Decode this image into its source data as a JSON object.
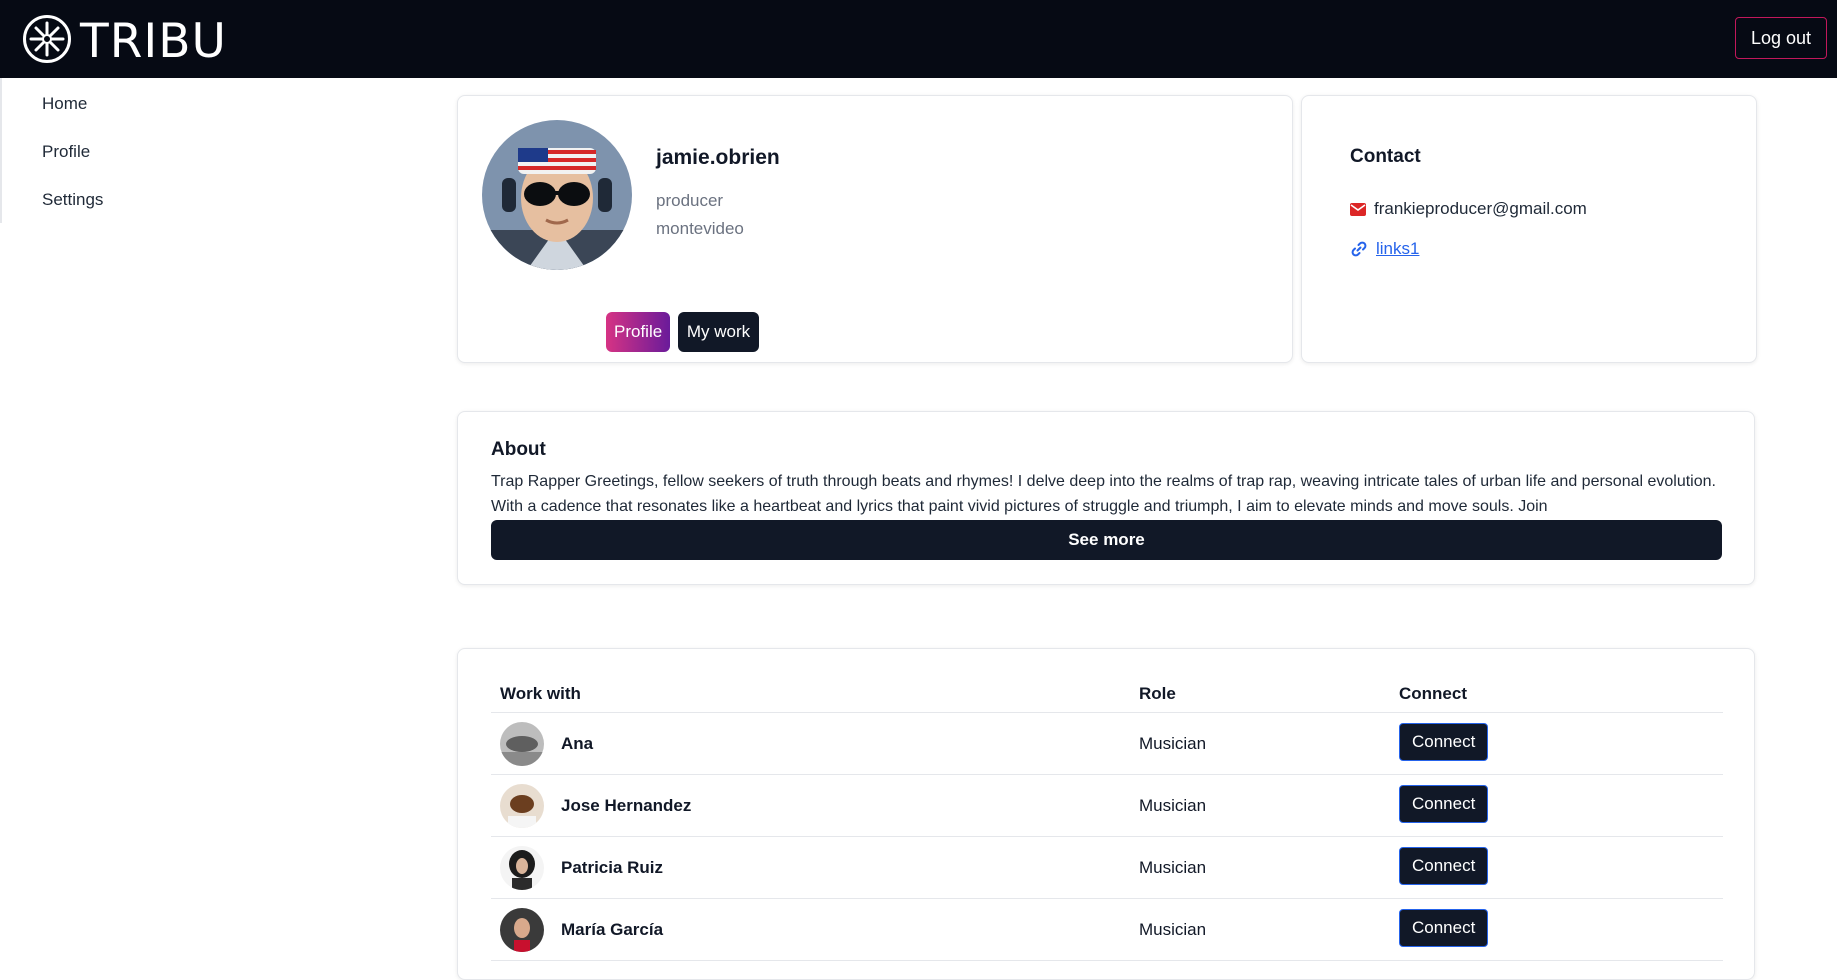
{
  "app": {
    "logo_text": "TRIBU",
    "logout_label": "Log out"
  },
  "sidebar": {
    "items": [
      {
        "label": "Home"
      },
      {
        "label": "Profile"
      },
      {
        "label": "Settings"
      }
    ]
  },
  "profile": {
    "username": "jamie.obrien",
    "role": "producer",
    "city": "montevideo",
    "tabs": [
      {
        "label": "Profile",
        "active": true
      },
      {
        "label": "My work",
        "active": false
      }
    ]
  },
  "contact": {
    "title": "Contact",
    "email": "frankieproducer@gmail.com",
    "link_label": "links1"
  },
  "about": {
    "title": "About",
    "text": "Trap Rapper Greetings, fellow seekers of truth through beats and rhymes! I delve deep into the realms of trap rap, weaving intricate tales of urban life and personal evolution. With a cadence that resonates like a heartbeat and lyrics that paint vivid pictures of struggle and triumph, I aim to elevate minds and move souls. Join",
    "see_more_label": "See more"
  },
  "work_with": {
    "headers": {
      "name": "Work with",
      "role": "Role",
      "connect": "Connect"
    },
    "rows": [
      {
        "name": "Ana",
        "role": "Musician",
        "connect_label": "Connect"
      },
      {
        "name": "Jose Hernandez",
        "role": "Musician",
        "connect_label": "Connect"
      },
      {
        "name": "Patricia Ruiz",
        "role": "Musician",
        "connect_label": "Connect"
      },
      {
        "name": "María García",
        "role": "Musician",
        "connect_label": "Connect"
      }
    ]
  },
  "colors": {
    "topbar_bg": "#060a14",
    "accent_gradient_start": "#d63384",
    "accent_gradient_end": "#6a1b9a",
    "dark_button": "#111827",
    "email_icon": "#dc2626",
    "link": "#2563eb"
  },
  "icons": {
    "logo": "compass-snowflake-icon",
    "email": "envelope-icon",
    "link": "link-chain-icon"
  }
}
